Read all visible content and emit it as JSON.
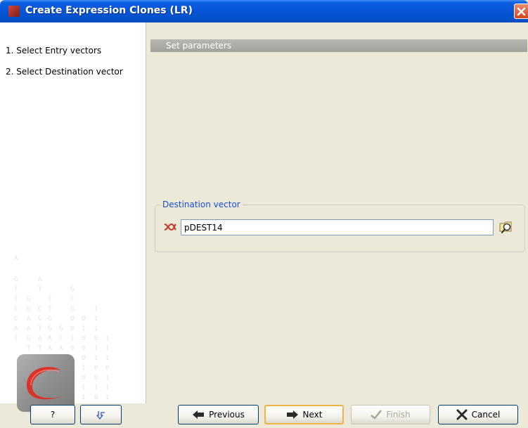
{
  "window": {
    "title": "Create Expression Clones (LR)",
    "icon": "app-icon"
  },
  "steps": [
    {
      "label": "1.  Select Entry vectors"
    },
    {
      "label": "2.  Select Destination vector"
    }
  ],
  "section": {
    "header": "Set parameters"
  },
  "destination": {
    "legend": "Destination vector",
    "value": "pDEST14",
    "sequence_icon": "sequence-icon",
    "browse_icon": "browse-folder-icon"
  },
  "buttons": {
    "help": "?",
    "previous": "Previous",
    "next": "Next",
    "finish": "Finish",
    "cancel": "Cancel"
  },
  "colors": {
    "titlebar": "#0655d8",
    "accent_legend": "#1a4ed6",
    "default_button_border": "#f2b24a"
  }
}
